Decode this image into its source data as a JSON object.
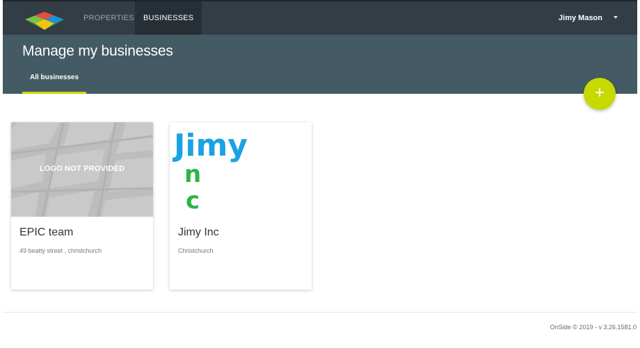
{
  "nav": {
    "items": [
      {
        "label": "PROPERTIES"
      },
      {
        "label": "BUSINESSES"
      }
    ],
    "user_name": "Jimy Mason"
  },
  "header": {
    "title": "Manage my businesses",
    "tabs": [
      {
        "label": "All businesses",
        "active": true
      }
    ]
  },
  "fab": {
    "label": "+",
    "color": "#c6da00"
  },
  "businesses": [
    {
      "name": "EPIC team",
      "address": "49 beatty street , christchurch",
      "logo_text": "LOGO NOT PROVIDED"
    },
    {
      "name": "Jimy Inc",
      "address": "Christchurch",
      "logo_lines": [
        "Jimy",
        "n",
        "c"
      ]
    }
  ],
  "footer": {
    "text": "OnSide © 2019 - v 3.26.1581.0"
  },
  "colors": {
    "topbar": "#323d45",
    "header": "#445a64",
    "accent": "#c5d800",
    "logo_blue": "#1aa3e0",
    "logo_green": "#2fb34a"
  }
}
